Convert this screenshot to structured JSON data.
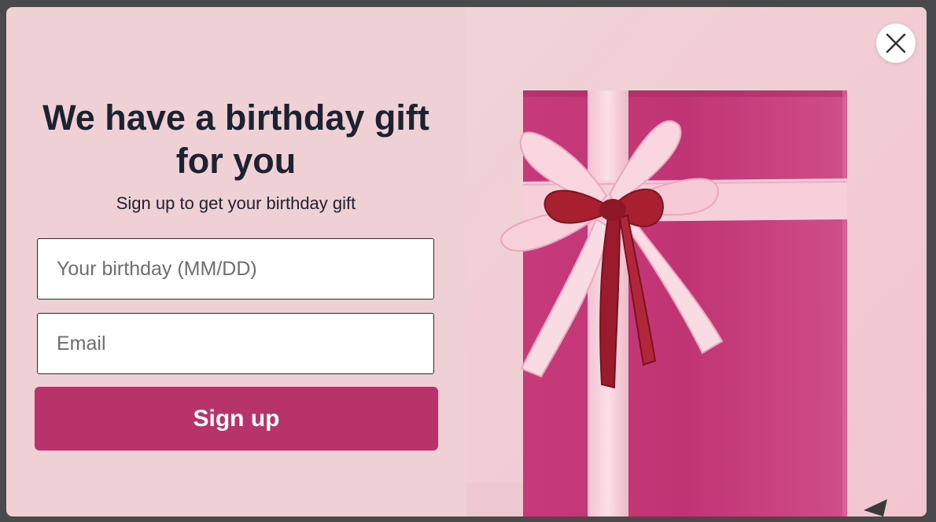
{
  "popup": {
    "title": "We have a birthday gift for you",
    "subtitle": "Sign up to get your birthday gift",
    "birthday_placeholder": "Your birthday (MM/DD)",
    "email_placeholder": "Email",
    "submit_label": "Sign up",
    "close_icon": "close-icon",
    "image": "gift-box-image"
  },
  "colors": {
    "background": "#eed0d5",
    "button": "#b8336a",
    "heading": "#1d2230",
    "gift_box": "#c43477",
    "ribbon": "#f8d4df",
    "bow_center": "#a51c2e"
  }
}
